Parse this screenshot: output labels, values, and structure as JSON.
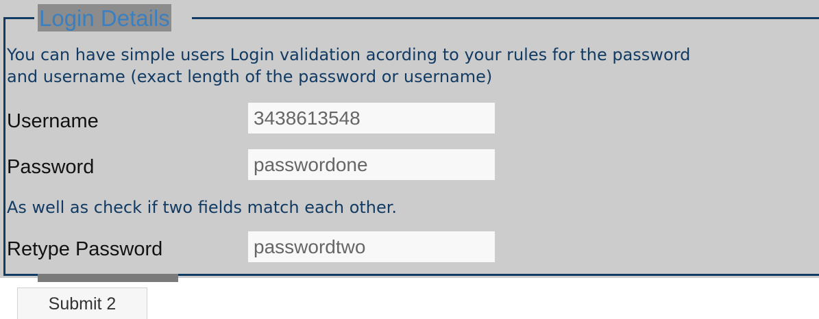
{
  "form": {
    "legend": "Login Details",
    "intro_line1": "You can have simple users Login validation acording to your rules for the password",
    "intro_line2": "and username (exact length of the password or username)",
    "match_note": "As well as check if two fields match each other.",
    "fields": {
      "username": {
        "label": "Username",
        "value": "3438613548"
      },
      "password": {
        "label": "Password",
        "value": "passwordone"
      },
      "retype_password": {
        "label": "Retype Password",
        "value": "passwordtwo"
      }
    },
    "submit_label": "Submit 2"
  },
  "colors": {
    "panel_background": "#cccccc",
    "border": "#123b63",
    "legend_text": "#3a7fc0",
    "legend_highlight": "#8c8c8c",
    "body_text": "#123b63"
  }
}
